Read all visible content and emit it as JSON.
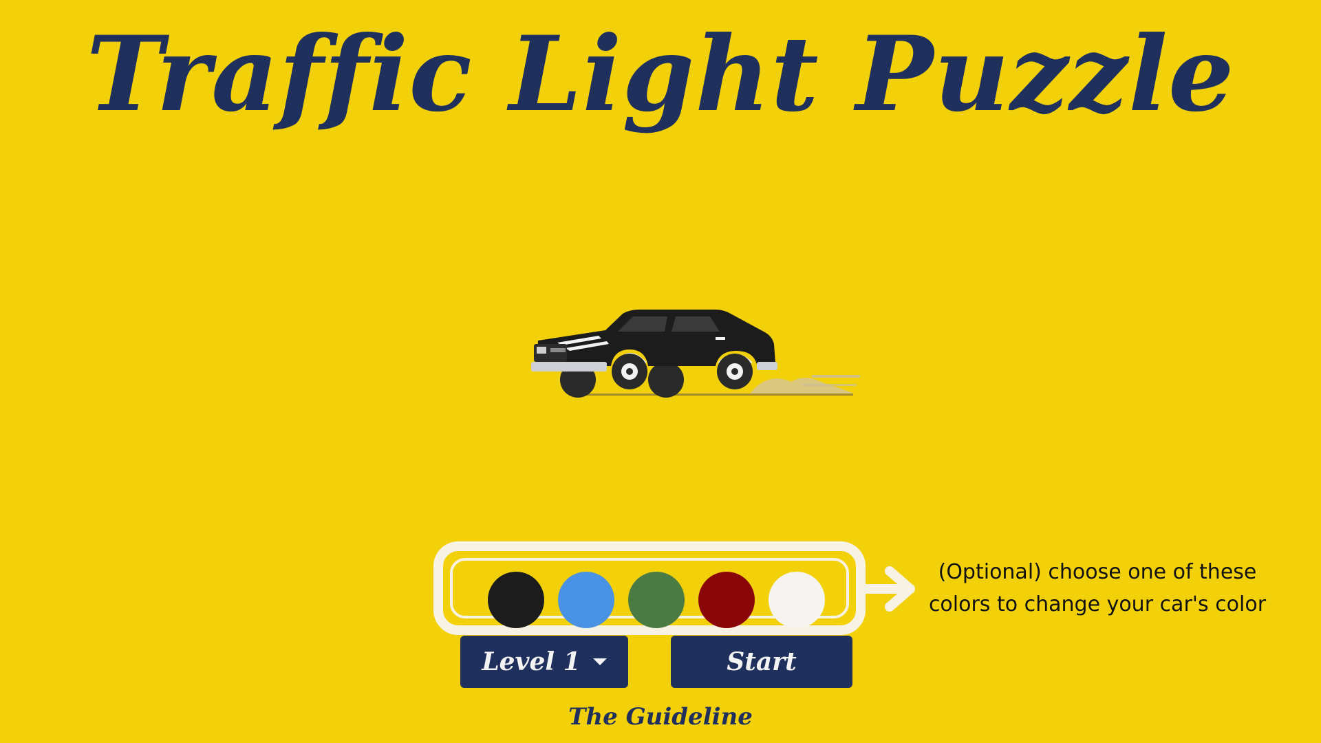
{
  "title": "Traffic Light Puzzle",
  "car": {
    "body_color": "#1c1c1c"
  },
  "palette": {
    "swatches": [
      {
        "name": "black",
        "color": "#1c1c1c"
      },
      {
        "name": "blue",
        "color": "#4a92e3"
      },
      {
        "name": "green",
        "color": "#4a7b42"
      },
      {
        "name": "red",
        "color": "#8a0508"
      },
      {
        "name": "white",
        "color": "#f5f4f1"
      }
    ]
  },
  "hint": {
    "line1": "(Optional) choose one of these",
    "line2": "colors to change your car's color"
  },
  "buttons": {
    "level_label": "Level 1",
    "start_label": "Start"
  },
  "footer": "The Guideline",
  "theme": {
    "background": "#f2d10b",
    "navy": "#20305d",
    "frame": "#f7f2e4"
  }
}
